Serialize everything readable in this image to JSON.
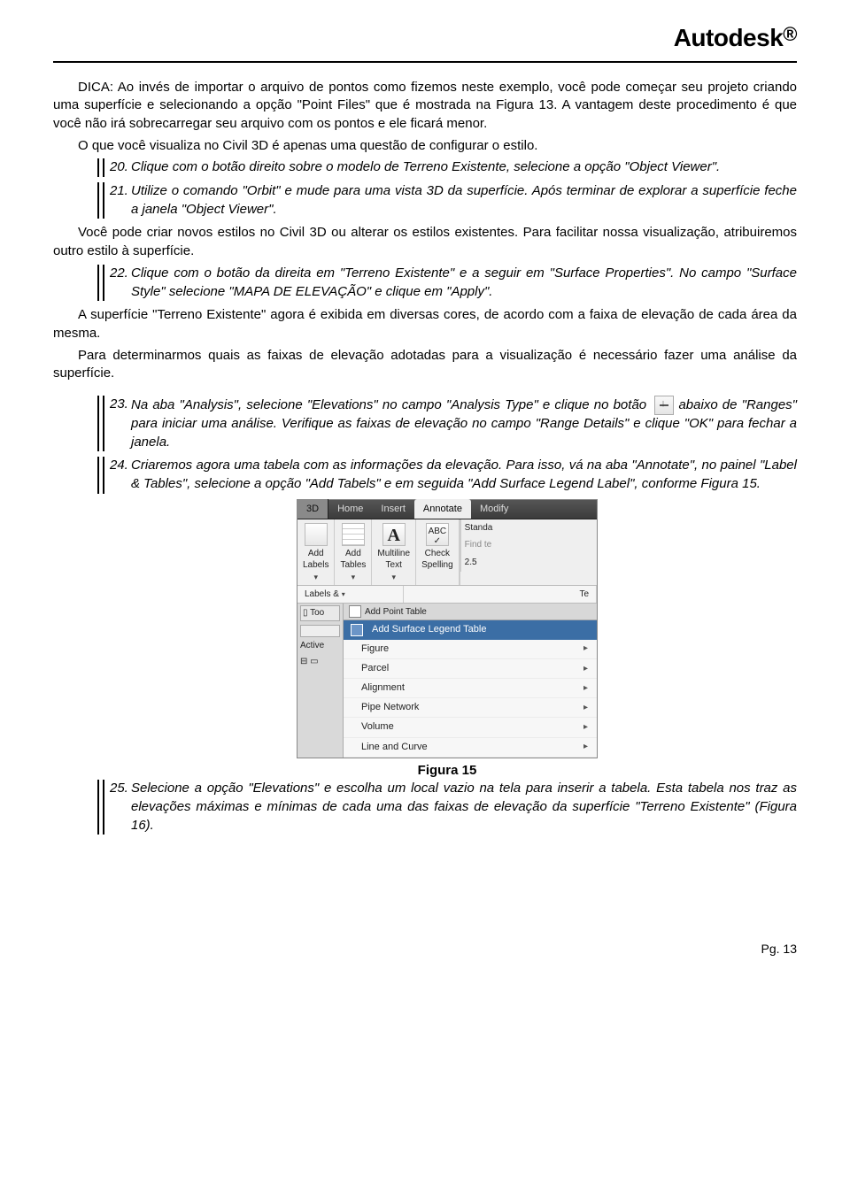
{
  "brand": "Autodesk",
  "tip": "DICA: Ao invés de importar o arquivo de pontos como fizemos neste exemplo, você pode começar seu projeto criando uma superfície e selecionando a opção \"Point Files\" que é mostrada na Figura 13. A vantagem deste procedimento é que você não irá sobrecarregar seu arquivo com os pontos e ele ficará menor.",
  "para1": "O que você visualiza no Civil 3D é apenas uma questão de configurar o estilo.",
  "items": {
    "n20": {
      "num": "20.",
      "text": "Clique com o botão direito sobre o modelo de Terreno Existente, selecione a opção \"Object Viewer\"."
    },
    "n21": {
      "num": "21.",
      "text": "Utilize o comando \"Orbit\" e mude para uma vista 3D da superfície. Após terminar de explorar a superfície feche a janela \"Object Viewer\"."
    },
    "n22": {
      "num": "22.",
      "text": "Clique com o botão da direita em \"Terreno Existente\" e a seguir em \"Surface Properties\". No campo \"Surface Style\" selecione \"MAPA DE ELEVAÇÃO\" e clique em \"Apply\"."
    },
    "n23": {
      "num": "23.",
      "text_a": "Na aba \"Analysis\", selecione \"Elevations\" no campo \"Analysis Type\" e clique no botão",
      "text_b": "abaixo de \"Ranges\" para iniciar uma análise. Verifique as faixas de elevação no campo \"Range Details\" e clique \"OK\" para fechar a janela."
    },
    "n24": {
      "num": "24.",
      "text": "Criaremos agora uma tabela com as informações da elevação. Para isso, vá na aba \"Annotate\", no painel \"Label & Tables\", selecione a opção \"Add Tabels\" e em seguida \"Add Surface Legend Label\", conforme Figura 15."
    },
    "n25": {
      "num": "25.",
      "text": "Selecione a opção \"Elevations\" e escolha um local vazio na tela para inserir a tabela. Esta tabela nos traz as elevações máximas e mínimas de cada uma das faixas de elevação da superfície \"Terreno Existente\" (Figura 16)."
    }
  },
  "para2": "Você pode criar novos estilos no Civil 3D ou alterar os estilos existentes. Para facilitar nossa visualização, atribuiremos outro estilo à superfície.",
  "para3": "A superfície \"Terreno Existente\" agora é exibida em diversas cores, de acordo com a faixa de elevação de cada área da mesma.",
  "para4": "Para determinarmos quais as faixas de elevação adotadas para a visualização é necessário fazer uma análise da superfície.",
  "figure": {
    "caption": "Figura 15",
    "tabs": {
      "d3": "3D",
      "home": "Home",
      "insert": "Insert",
      "annotate": "Annotate",
      "modify": "Modify"
    },
    "panels": {
      "addLabels": "Add\nLabels",
      "addTables": "Add\nTables",
      "multiline": "Multiline\nText",
      "check": "Check\nSpelling",
      "standa": "Standa",
      "findte": "Find te",
      "twofive": "2.5"
    },
    "row2": {
      "labels": "Labels &",
      "te": "Te"
    },
    "dropdown": {
      "header": "Add Point Table",
      "active": "Add Surface Legend Table",
      "items": [
        "Figure",
        "Parcel",
        "Alignment",
        "Pipe Network",
        "Volume",
        "Line and Curve"
      ]
    },
    "side": {
      "too": "Too",
      "active": "Active"
    }
  },
  "footer": "Pg. 13"
}
